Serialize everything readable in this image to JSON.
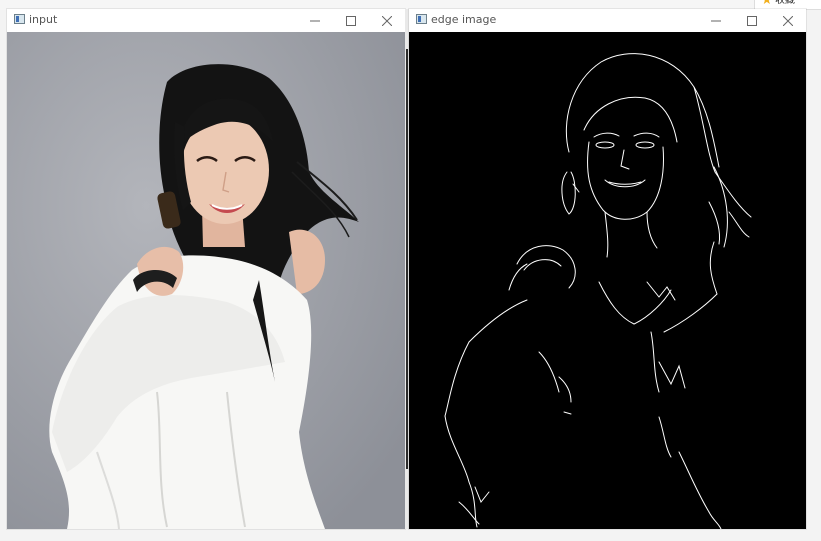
{
  "windows": {
    "input": {
      "title": "input",
      "controls": {
        "minimize_icon": "minimize-icon",
        "maximize_icon": "maximize-icon",
        "close_icon": "close-icon"
      },
      "content": "photo"
    },
    "edge": {
      "title": "edge image",
      "controls": {
        "minimize_icon": "minimize-icon",
        "maximize_icon": "maximize-icon",
        "close_icon": "close-icon"
      },
      "content": "edge-map"
    }
  },
  "corner_badge": {
    "icon": "star-icon",
    "label": "收藏"
  },
  "colors": {
    "photo_background": "#9b9ea6",
    "edge_background": "#000000",
    "edge_lines": "#ffffff",
    "hair": "#141414",
    "dress": "#f7f7f5",
    "skin": "#e9c3ac"
  }
}
